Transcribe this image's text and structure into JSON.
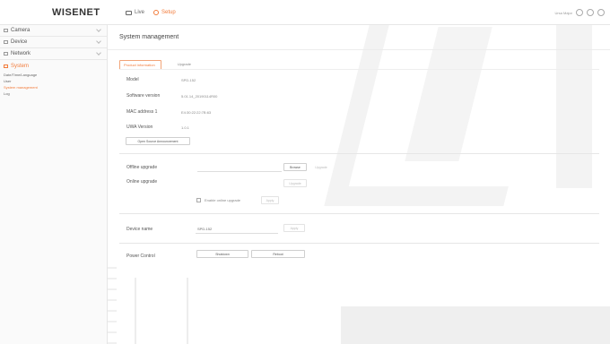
{
  "brand": {
    "logo": "WISENET"
  },
  "topnav": [
    {
      "label": "Live",
      "icon": "monitor-icon"
    },
    {
      "label": "Setup",
      "icon": "gear-icon"
    }
  ],
  "top_right": {
    "user": "Ursa Major",
    "icons": [
      "user-icon",
      "help-icon",
      "logout-icon"
    ]
  },
  "sidebar": {
    "groups": [
      {
        "label": "Camera",
        "icon": "camera-icon"
      },
      {
        "label": "Device",
        "icon": "device-icon"
      },
      {
        "label": "Network",
        "icon": "network-icon"
      },
      {
        "label": "System",
        "icon": "system-icon"
      }
    ],
    "system_items": [
      "Date/Time/Language",
      "User",
      "System management",
      "Log"
    ]
  },
  "page": {
    "title": "System management"
  },
  "tabs": [
    "Product information",
    "Upgrade"
  ],
  "info": {
    "model_label": "Model",
    "model_value": "SPD-152",
    "software_label": "Software version",
    "software_value": "5.01.14_20190114R00",
    "mac_label": "MAC address 1",
    "mac_value": "E4:30:22:22:7B:63",
    "uwa_label": "UWA Version",
    "uwa_value": "1.0.1"
  },
  "buttons": {
    "open_source": "Open Source Announcement",
    "browse": "Browse",
    "upgrade": "Upgrade",
    "upgrade2": "Upgrade",
    "apply_online": "Apply",
    "apply_name": "Apply",
    "shutdown": "Shutdown",
    "reboot": "Reboot"
  },
  "upgrade": {
    "offline_label": "Offline upgrade",
    "online_label": "Online upgrade",
    "enable_label": "Enable online upgrade"
  },
  "device": {
    "name_label": "Device name",
    "name_value": "SPD-152"
  },
  "power": {
    "label": "Power Control"
  }
}
